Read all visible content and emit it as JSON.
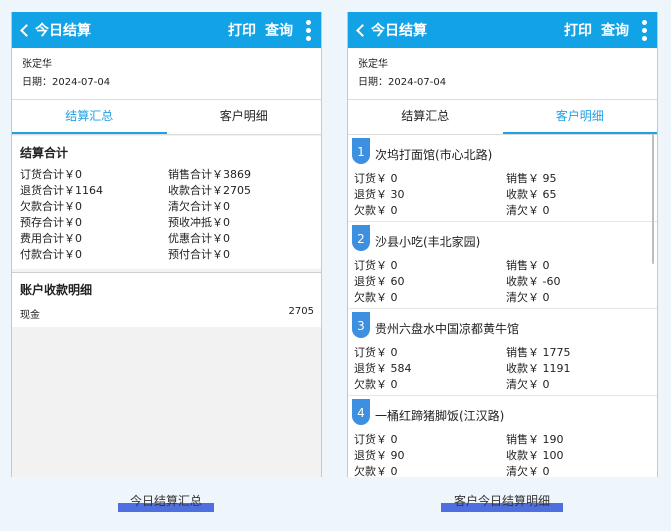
{
  "phone1": {
    "title": "今日结算",
    "print_label": "打印",
    "query_label": "查询",
    "person": "张定华",
    "date": "日期：2024-07-04",
    "tab_summary": "结算汇总",
    "tab_detail": "客户明细",
    "summary_title": "结算合计",
    "summary_left": [
      "订货合计￥0",
      "退货合计￥1164",
      "欠款合计￥0",
      "预存合计￥0",
      "费用合计￥0",
      "付款合计￥0"
    ],
    "summary_right": [
      "销售合计￥3869",
      "收款合计￥2705",
      "清欠合计￥0",
      "预收冲抵￥0",
      "优惠合计￥0",
      "预付合计￥0"
    ],
    "account_title": "账户收款明细",
    "account_name": "现金",
    "account_value": "2705"
  },
  "phone2": {
    "title": "今日结算",
    "print_label": "打印",
    "query_label": "查询",
    "person": "张定华",
    "date": "日期：2024-07-04",
    "tab_summary": "结算汇总",
    "tab_detail": "客户明细",
    "customers": [
      {
        "no": "1",
        "name": "次坞打面馆(市心北路)",
        "c1": [
          "订货￥ 0",
          "退货￥ 30",
          "欠款￥ 0"
        ],
        "c2": [
          "销售￥ 95",
          "收款￥ 65",
          "清欠￥ 0"
        ]
      },
      {
        "no": "2",
        "name": "沙县小吃(丰北家园)",
        "c1": [
          "订货￥ 0",
          "退货￥ 60",
          "欠款￥ 0"
        ],
        "c2": [
          "销售￥ 0",
          "收款￥ -60",
          "清欠￥ 0"
        ]
      },
      {
        "no": "3",
        "name": "贵州六盘水中国凉都黄牛馆",
        "c1": [
          "订货￥ 0",
          "退货￥ 584",
          "欠款￥ 0"
        ],
        "c2": [
          "销售￥ 1775",
          "收款￥ 1191",
          "清欠￥ 0"
        ]
      },
      {
        "no": "4",
        "name": "一桶红蹄猪脚饭(江汉路)",
        "c1": [
          "订货￥ 0",
          "退货￥ 90",
          "欠款￥ 0"
        ],
        "c2": [
          "销售￥ 190",
          "收款￥ 100",
          "清欠￥ 0"
        ]
      }
    ]
  },
  "captions": {
    "left": "今日结算汇总",
    "right": "客户今日结算明细"
  },
  "colors": {
    "header": "#12a3e6",
    "tab_active": "#1fa1e8",
    "badge": "#3d8fe0",
    "caption_bar": "#4f6fe0"
  }
}
